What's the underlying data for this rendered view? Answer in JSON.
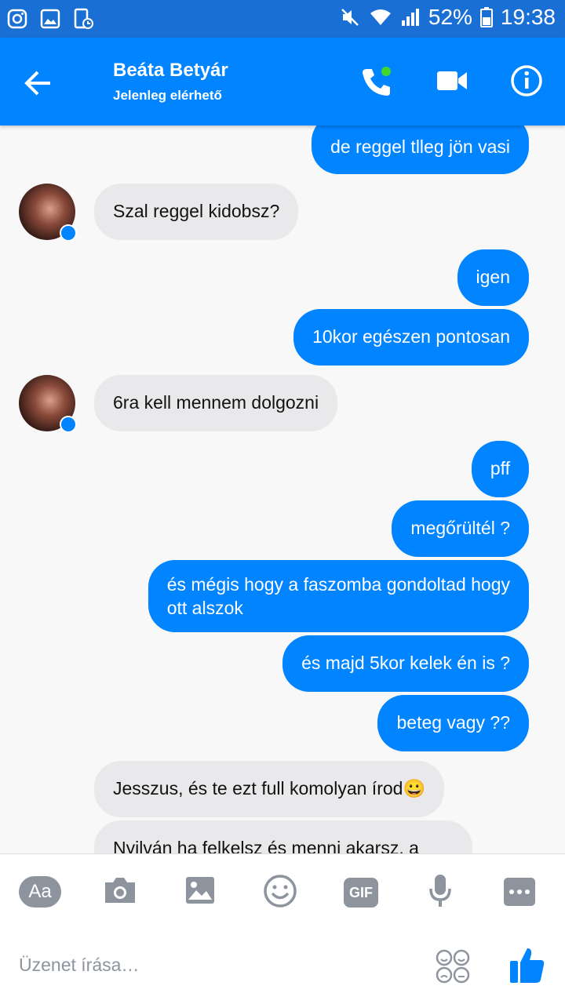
{
  "status_bar": {
    "battery": "52%",
    "time": "19:38"
  },
  "header": {
    "contact_name": "Beáta Betyár",
    "status": "Jelenleg elérhető"
  },
  "messages": [
    {
      "from": "me",
      "text": "de reggel tlleg jön vasi",
      "partial": true
    },
    {
      "from": "them",
      "text": "Szal reggel kidobsz?"
    },
    {
      "from": "me",
      "text": "igen"
    },
    {
      "from": "me",
      "text": "10kor egészen pontosan"
    },
    {
      "from": "them",
      "text": "6ra kell mennem dolgozni"
    },
    {
      "from": "me",
      "text": "pff"
    },
    {
      "from": "me",
      "text": "megőrültél ?"
    },
    {
      "from": "me",
      "lines": [
        "és mégis hogy a faszomba gondoltad hogy",
        "ott alszok"
      ]
    },
    {
      "from": "me",
      "text": "és majd 5kor kelek én is ?"
    },
    {
      "from": "me",
      "text": "beteg vagy ??"
    },
    {
      "from": "them",
      "text": "Jesszus, és te ezt full komolyan írod",
      "emoji": "😀"
    },
    {
      "from": "them",
      "text": "Nyilván ha felkelsz és menni akarsz, a",
      "partial": true
    }
  ],
  "composer": {
    "aa_label": "Aa",
    "gif_label": "GIF",
    "placeholder": "Üzenet írása…"
  },
  "colors": {
    "accent": "#0084ff",
    "status_bar": "#1a6fd4",
    "incoming_bubble": "#e9e9eb",
    "icon_gray": "#8d949e",
    "online_dot": "#44d62c"
  },
  "icons": [
    "instagram-icon",
    "gallery-icon",
    "screenshot-icon",
    "mute-icon",
    "wifi-icon",
    "signal-icon",
    "battery-icon",
    "back-arrow-icon",
    "phone-icon",
    "video-camera-icon",
    "info-icon",
    "camera-icon",
    "image-icon",
    "emoji-icon",
    "microphone-icon",
    "more-icon",
    "stickers-icon",
    "thumbs-up-icon"
  ]
}
